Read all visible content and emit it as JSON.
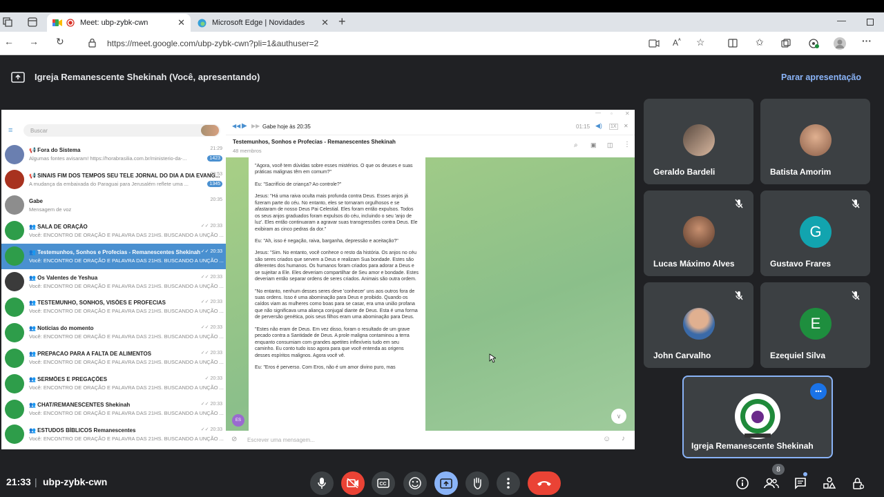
{
  "browser": {
    "tabs": [
      {
        "title": "Meet: ubp-zybk-cwn",
        "close": "✕"
      },
      {
        "title": "Microsoft Edge | Novidades",
        "close": "✕"
      }
    ],
    "new_tab": "+",
    "url": "https://meet.google.com/ubp-zybk-cwn?pli=1&authuser=2"
  },
  "meet": {
    "presenting_title": "Igreja Remanescente Shekinah (Você, apresentando)",
    "stop_presenting": "Parar apresentação",
    "time": "21:33",
    "meeting_code": "ubp-zybk-cwn",
    "participants_count": "8",
    "participants": [
      {
        "name": "Geraldo Bardeli",
        "muted": false,
        "initial": ""
      },
      {
        "name": "Batista Amorim",
        "muted": false,
        "initial": ""
      },
      {
        "name": "Lucas Máximo Alves",
        "muted": true,
        "initial": ""
      },
      {
        "name": "Gustavo Frares",
        "muted": true,
        "initial": "G",
        "color": "#12a4af"
      },
      {
        "name": "John Carvalho",
        "muted": true,
        "initial": ""
      },
      {
        "name": "Ezequiel Silva",
        "muted": true,
        "initial": "E",
        "color": "#1e8e3e"
      }
    ],
    "self": {
      "name": "Igreja Remanescente Shekinah"
    }
  },
  "telegram": {
    "search_placeholder": "Buscar",
    "chats": [
      {
        "name": "📢 Fora do Sistema",
        "preview": "Algumas fontes avisaram! https://horabrasilia.com.br/ministerio-da-...",
        "time": "21:29",
        "badge": "1423",
        "color": "#6a7fb0"
      },
      {
        "name": "📢 SINAIS FIM DOS TEMPOS SEU TELE JORNAL DO DIA A DIA EVANG...",
        "preview": "A mudança da embaixada do Paraguai para Jerusalém reflete uma ...",
        "time": "20:53",
        "badge": "1345",
        "color": "#a8321f"
      },
      {
        "name": "Gabe",
        "preview": "Mensagem de voz",
        "time": "20:35",
        "badge": "",
        "color": "#8d8d8d"
      },
      {
        "name": "👥 SALA DE ORAÇÃO",
        "preview": "Você: ENCONTRO DE ORAÇÃO E PALAVRA DAS 21HS.  BUSCANDO A UNÇÃO ...",
        "time": "✓✓ 20:33",
        "badge": "",
        "color": "#2e9d4a"
      },
      {
        "name": "👥 Testemunhos, Sonhos e Profecias - Remanescentes Shekinah",
        "preview": "Você: ENCONTRO DE ORAÇÃO E PALAVRA DAS 21HS.  BUSCANDO A UNÇÃO ...",
        "time": "✓✓ 20:33",
        "badge": "",
        "color": "#2e9d4a"
      },
      {
        "name": "👥 Os Valentes de Yeshua",
        "preview": "Você: ENCONTRO DE ORAÇÃO E PALAVRA DAS 21HS.  BUSCANDO A UNÇÃO ...",
        "time": "✓✓ 20:33",
        "badge": "",
        "color": "#3b3b3b"
      },
      {
        "name": "👥 TESTEMUNHO, SONHOS, VISÕES E PROFECIAS",
        "preview": "Você: ENCONTRO DE ORAÇÃO E PALAVRA DAS 21HS.  BUSCANDO A UNÇÃO ...",
        "time": "✓✓ 20:33",
        "badge": "",
        "color": "#2e9d4a"
      },
      {
        "name": "👥 Notícias do momento",
        "preview": "Você: ENCONTRO DE ORAÇÃO E PALAVRA DAS 21HS.  BUSCANDO A UNÇÃO ...",
        "time": "✓✓ 20:33",
        "badge": "",
        "color": "#2e9d4a"
      },
      {
        "name": "👥 PREPACAO PARA A FALTA DE ALIMENTOS",
        "preview": "Você: ENCONTRO DE ORAÇÃO E PALAVRA DAS 21HS.  BUSCANDO A UNÇÃO ...",
        "time": "✓✓ 20:33",
        "badge": "",
        "color": "#2e9d4a"
      },
      {
        "name": "👥 SERMÕES E PREGAÇÕES",
        "preview": "Você: ENCONTRO DE ORAÇÃO E PALAVRA DAS 21HS.  BUSCANDO A UNÇÃO ...",
        "time": "✓ 20:33",
        "badge": "",
        "color": "#2e9d4a"
      },
      {
        "name": "👥 CHAT/REMANESCENTES Shekinah",
        "preview": "Você: ENCONTRO DE ORAÇÃO E PALAVRA DAS 21HS.  BUSCANDO A UNÇÃO ...",
        "time": "✓✓ 20:33",
        "badge": "",
        "color": "#2e9d4a"
      },
      {
        "name": "👥 ESTUDOS BÍBLICOS Remanescentes",
        "preview": "Você: ENCONTRO DE ORAÇÃO E PALAVRA DAS 21HS.  BUSCANDO A UNÇÃO ...",
        "time": "✓✓ 20:33",
        "badge": "",
        "color": "#2e9d4a"
      }
    ],
    "player": {
      "title": "Gabe hoje às 20:35",
      "time": "01:15",
      "speed": "1X"
    },
    "chat_title": "Testemunhos, Sonhos e Profecias - Remanescentes Shekinah",
    "chat_members": "48 membros",
    "message_paragraphs": [
      "\"Agora, você tem dúvidas sobre esses mistérios. O que os deuses e suas práticas malignas têm em comum?\"",
      "Eu: \"Sacrifício de criança? Ao controle?\"",
      "Jesus: \"Há uma raiva oculta mais profunda contra Deus. Esses anjos já fizeram parte do céu. No entanto, eles se tornaram orgulhosos e se afastaram de nosso Deus Pai Celestial. Eles foram então expulsos. Todos os seus anjos graduados foram expulsos do céu, incluindo o seu 'anjo de luz'. Eles então continuaram a agravar suas transgressões contra Deus. Ele exibiram as cinco pedras da dor.\"",
      "Eu: \"Ah, isso é negação, raiva, barganha, depressão e aceitação?\"",
      "Jesus: \"Sim. No entanto, você conhece o resto da história. Os anjos no céu são seres criados que servem a Deus e realizam Sua bondade. Estes são diferentes dos humanos. Os humanos foram criados para adorar a Deus e se sujeitar a Ele. Eles deveriam compartilhar de Seu amor e bondade. Estes deveriam então separar ordens de seres criados. Animais são outra ordem.",
      "\"No entanto, nenhum desses seres deve 'conhecer' uns aos outros fora de suas ordens. Isso é uma abominação para Deus e proibido. Quando os caídos viam as mulheres como boas para se casar, era uma união profana que não significava uma aliança conjugal diante de Deus. Esta é uma forma de perversão genética, pois seus filhos eram uma abominação para Deus.",
      "\"Estes não eram de Deus. Em vez disso, foram o resultado de um grave pecado contra a Santidade de Deus. A prole maligna contaminou a terra enquanto consumiam com grandes apetites inflexíveis tudo em seu caminho. Eu conto tudo isso agora para que você entenda as origens desses espíritos malignos. Agora você vê.",
      "Eu: \"Eros é perverso. Com Eros, não é um amor divino puro, mas"
    ],
    "sender_initials": "ES",
    "composer_placeholder": "Escrever uma mensagem..."
  }
}
